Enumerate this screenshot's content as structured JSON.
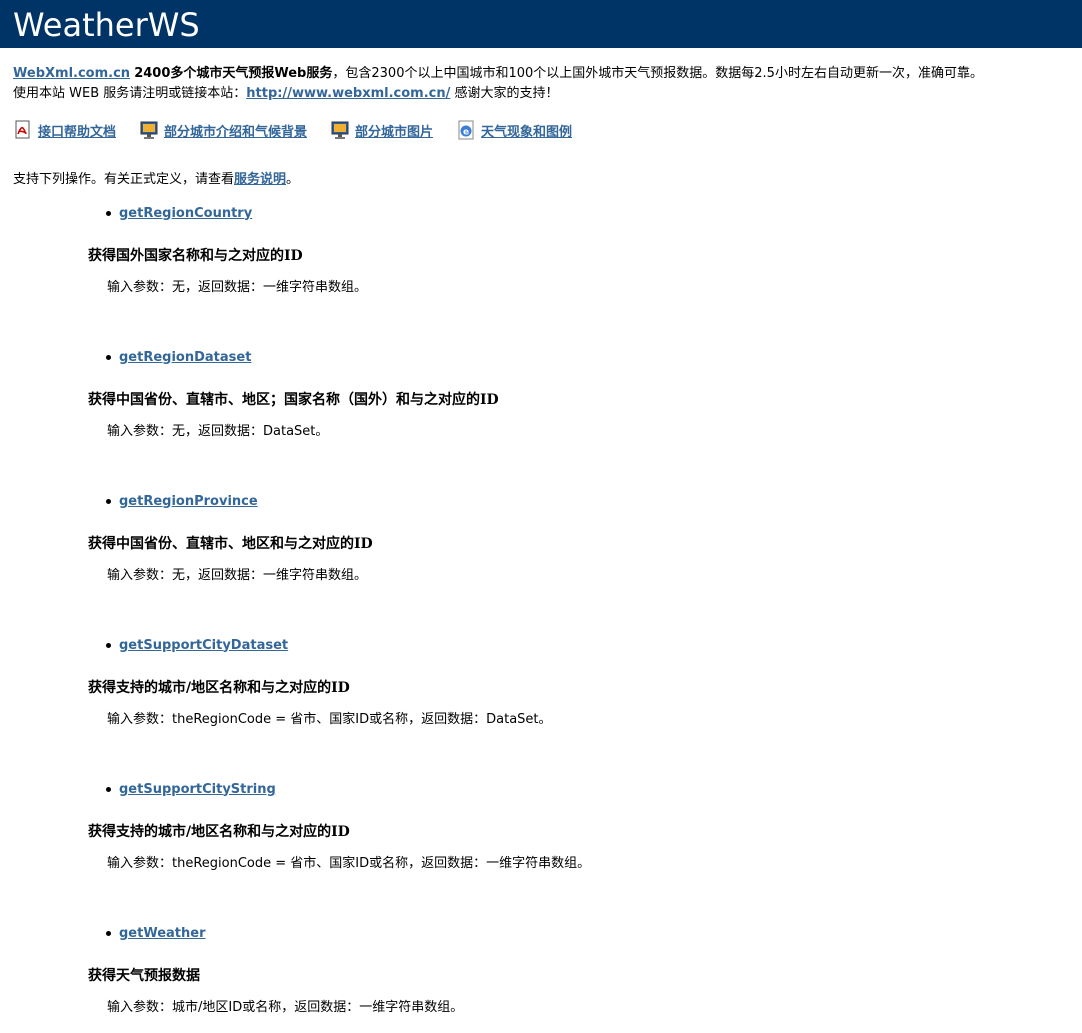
{
  "header": {
    "title": "WeatherWS"
  },
  "intro": {
    "site_link": "WebXml.com.cn",
    "bold_text": "2400多个城市天气预报Web服务",
    "rest_line1": "，包含2300个以上中国城市和100个以上国外城市天气预报数据。数据每2.5小时左右自动更新一次，准确可靠。",
    "line2_prefix": "使用本站 WEB 服务请注明或链接本站：",
    "url_link": "http://www.webxml.com.cn/",
    "line2_suffix": " 感谢大家的支持！"
  },
  "links": [
    {
      "label": "接口帮助文档",
      "icon": "pdf-icon"
    },
    {
      "label": "部分城市介绍和气候背景",
      "icon": "monitor-icon"
    },
    {
      "label": "部分城市图片",
      "icon": "monitor-icon"
    },
    {
      "label": "天气现象和图例",
      "icon": "ie-icon"
    }
  ],
  "support": {
    "prefix": "支持下列操作。有关正式定义，请查看",
    "link": "服务说明",
    "suffix": "。"
  },
  "operations": [
    {
      "name": "getRegionCountry",
      "desc": "获得国外国家名称和与之对应的ID",
      "params": "输入参数：无，返回数据：一维字符串数组。"
    },
    {
      "name": "getRegionDataset",
      "desc": "获得中国省份、直辖市、地区；国家名称（国外）和与之对应的ID",
      "params": "输入参数：无，返回数据：DataSet。"
    },
    {
      "name": "getRegionProvince",
      "desc": "获得中国省份、直辖市、地区和与之对应的ID",
      "params": "输入参数：无，返回数据：一维字符串数组。"
    },
    {
      "name": "getSupportCityDataset",
      "desc": "获得支持的城市/地区名称和与之对应的ID",
      "params": "输入参数：theRegionCode = 省市、国家ID或名称，返回数据：DataSet。"
    },
    {
      "name": "getSupportCityString",
      "desc": "获得支持的城市/地区名称和与之对应的ID",
      "params": "输入参数：theRegionCode = 省市、国家ID或名称，返回数据：一维字符串数组。"
    },
    {
      "name": "getWeather",
      "desc": "获得天气预报数据",
      "params": "输入参数：城市/地区ID或名称，返回数据：一维字符串数组。"
    }
  ]
}
